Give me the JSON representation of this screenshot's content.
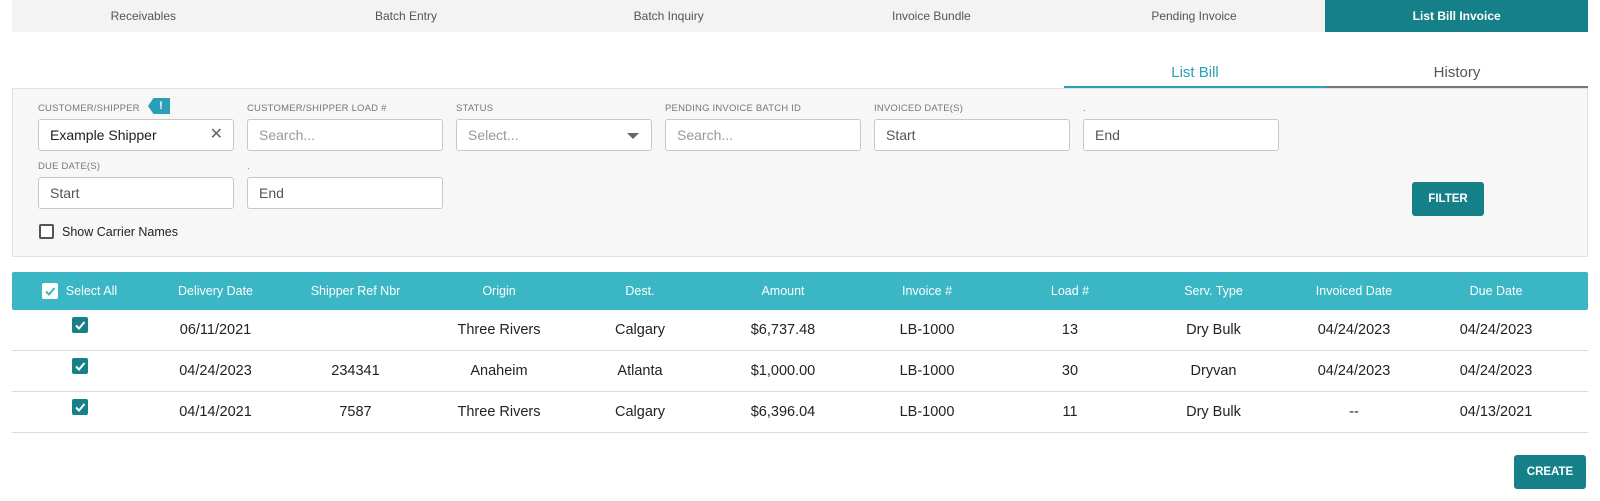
{
  "top_tabs": [
    {
      "label": "Receivables"
    },
    {
      "label": "Batch Entry"
    },
    {
      "label": "Batch Inquiry"
    },
    {
      "label": "Invoice Bundle"
    },
    {
      "label": "Pending Invoice"
    },
    {
      "label": "List Bill Invoice"
    }
  ],
  "active_top_tab": "List Bill Invoice",
  "sub_tabs": [
    {
      "label": "List Bill"
    },
    {
      "label": "History"
    }
  ],
  "filters": {
    "customer_label": "CUSTOMER/SHIPPER",
    "customer_value": "Example Shipper",
    "info_icon": "!",
    "load_label": "CUSTOMER/SHIPPER LOAD #",
    "load_placeholder": "Search...",
    "status_label": "STATUS",
    "status_placeholder": "Select...",
    "batch_label": "PENDING INVOICE BATCH ID",
    "batch_placeholder": "Search...",
    "invoiced_label": "INVOICED DATE(S)",
    "invoiced_start": "Start",
    "invoiced_end_label": ".",
    "invoiced_end": "End",
    "due_label": "DUE DATE(S)",
    "due_start": "Start",
    "due_end_label": ".",
    "due_end": "End",
    "show_carrier_names": "Show Carrier Names",
    "filter_button": "FILTER"
  },
  "table": {
    "select_all": "Select All",
    "columns": [
      "Delivery Date",
      "Shipper Ref Nbr",
      "Origin",
      "Dest.",
      "Amount",
      "Invoice #",
      "Load #",
      "Serv. Type",
      "Invoiced Date",
      "Due Date"
    ],
    "rows": [
      {
        "delivery_date": "06/11/2021",
        "shipper_ref": "",
        "origin": "Three Rivers",
        "dest": "Calgary",
        "amount": "$6,737.48",
        "invoice": "LB-1000",
        "load": "13",
        "serv_type": "Dry Bulk",
        "invoiced_date": "04/24/2023",
        "due_date": "04/24/2023"
      },
      {
        "delivery_date": "04/24/2023",
        "shipper_ref": "234341",
        "origin": "Anaheim",
        "dest": "Atlanta",
        "amount": "$1,000.00",
        "invoice": "LB-1000",
        "load": "30",
        "serv_type": "Dryvan",
        "invoiced_date": "04/24/2023",
        "due_date": "04/24/2023"
      },
      {
        "delivery_date": "04/14/2021",
        "shipper_ref": "7587",
        "origin": "Three Rivers",
        "dest": "Calgary",
        "amount": "$6,396.04",
        "invoice": "LB-1000",
        "load": "11",
        "serv_type": "Dry Bulk",
        "invoiced_date": "--",
        "due_date": "04/13/2021"
      }
    ]
  },
  "create_button": "CREATE",
  "colors": {
    "primary": "#168089",
    "header": "#3bb6c5",
    "accent": "#2a9fb6"
  }
}
